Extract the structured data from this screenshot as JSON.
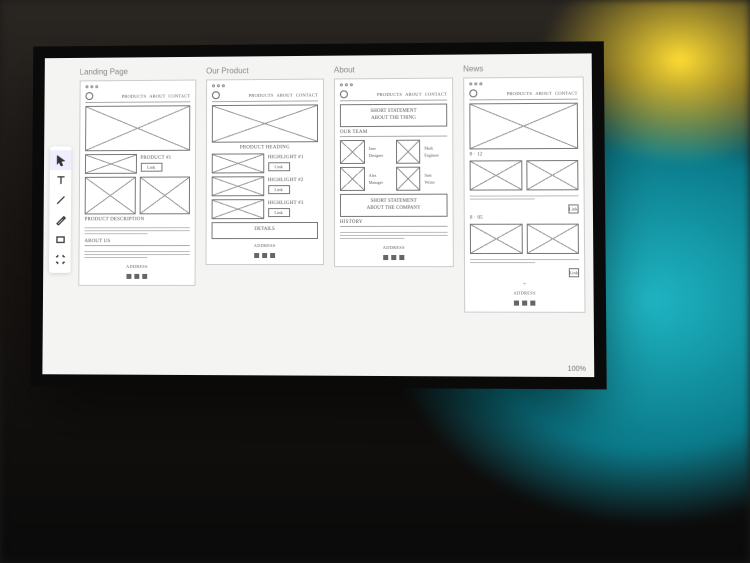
{
  "toolbar": {
    "tools": [
      "select",
      "text",
      "line",
      "pencil",
      "rectangle",
      "artboard"
    ]
  },
  "nav_items": [
    "Products",
    "About",
    "Contact"
  ],
  "artboards": [
    {
      "title": "Landing Page",
      "product1": "Product #1",
      "cta": "Link",
      "desc_heading": "Product Description",
      "about_heading": "About Us",
      "footer": "Address"
    },
    {
      "title": "Our Product",
      "hero_title": "Product Heading",
      "h1": "Highlight #1",
      "h2": "Highlight #2",
      "h3": "Highlight #3",
      "cta": "Link",
      "details": "Details",
      "footer": "Address"
    },
    {
      "title": "About",
      "statement1a": "Short statement",
      "statement1b": "about the thing",
      "ourteam": "Our Team",
      "p1a": "Jane",
      "p1b": "Designer",
      "p2a": "Mark",
      "p2b": "Engineer",
      "p3a": "Alex",
      "p3b": "Manager",
      "p4a": "Sam",
      "p4b": "Writer",
      "statement2a": "Short statement",
      "statement2b": "about the company",
      "history": "History",
      "footer": "Address"
    },
    {
      "title": "News",
      "dateA": "8 · 12",
      "dateB": "8 · 05",
      "cta": "Link",
      "footer": "Address"
    }
  ],
  "zoom": "100%"
}
